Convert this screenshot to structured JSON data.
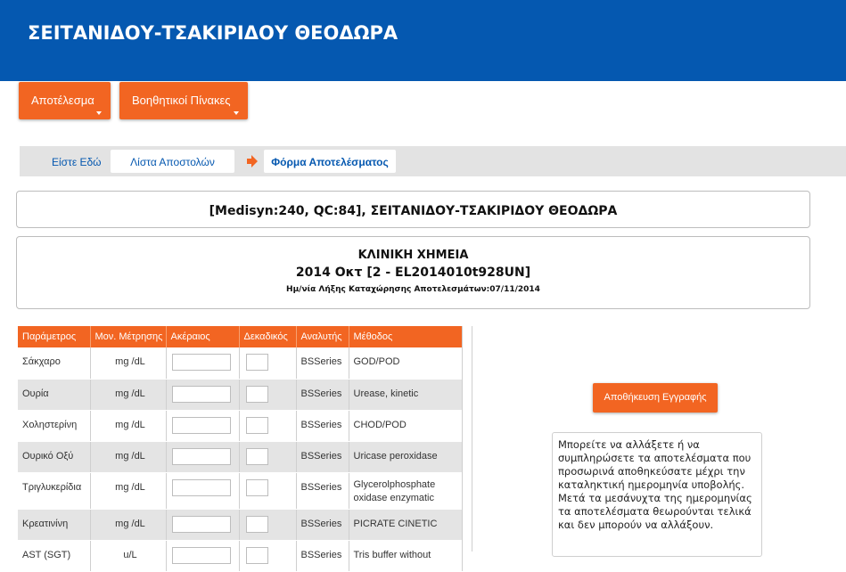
{
  "header": {
    "title": "ΣΕΙΤΑΝΙΔΟΥ-ΤΣΑΚΙΡΙΔΟΥ ΘΕΟΔΩΡΑ"
  },
  "menu": {
    "result_label": "Αποτέλεσμα",
    "tables_label": "Βοηθητικοί Πίνακες"
  },
  "breadcrumb": {
    "label": "Είστε Εδώ",
    "item1": "Λίστα Αποστολών",
    "item2": "Φόρμα Αποτελέσματος"
  },
  "patient": {
    "title": "[Medisyn:240, QC:84], ΣΕΙΤΑΝΙΔΟΥ-ΤΣΑΚΙΡΙΔΟΥ ΘΕΟΔΩΡΑ"
  },
  "section": {
    "title": "ΚΛΙΝΙΚΗ ΧΗΜΕΙΑ",
    "subtitle": "2014 Οκτ [2 - EL2014010t928UN]",
    "deadline": "Ημ/νία Λήξης Καταχώρησης Αποτελεσμάτων:07/11/2014"
  },
  "table": {
    "headers": [
      "Παράμετρος",
      "Μον. Μέτρησης",
      "Ακέραιος",
      "Δεκαδικός",
      "Αναλυτής",
      "Μέθοδος"
    ],
    "rows": [
      {
        "param": "Σάκχαρο",
        "unit": "mg /dL",
        "integer": "",
        "decimal": "",
        "analyzer": "BSSeries",
        "method": "GOD/POD"
      },
      {
        "param": "Ουρία",
        "unit": "mg /dL",
        "integer": "",
        "decimal": "",
        "analyzer": "BSSeries",
        "method": "Urease, kinetic"
      },
      {
        "param": "Χοληστερίνη",
        "unit": "mg /dL",
        "integer": "",
        "decimal": "",
        "analyzer": "BSSeries",
        "method": "CHOD/POD"
      },
      {
        "param": "Ουρικό Οξύ",
        "unit": "mg /dL",
        "integer": "",
        "decimal": "",
        "analyzer": "BSSeries",
        "method": "Uricase peroxidase"
      },
      {
        "param": "Τριγλυκερίδια",
        "unit": "mg /dL",
        "integer": "",
        "decimal": "",
        "analyzer": "BSSeries",
        "method": "Glycerolphosphate oxidase enzymatic"
      },
      {
        "param": "Κρεατινίνη",
        "unit": "mg /dL",
        "integer": "",
        "decimal": "",
        "analyzer": "BSSeries",
        "method": "PICRATE CINETIC"
      },
      {
        "param": "AST (SGT)",
        "unit": "u/L",
        "integer": "",
        "decimal": "",
        "analyzer": "BSSeries",
        "method": "Tris buffer without"
      }
    ]
  },
  "actions": {
    "save_label": "Αποθήκευση Εγγραφής"
  },
  "info": {
    "text": "Μπορείτε να αλλάξετε ή να συμπληρώσετε τα αποτελέσματα που προσωρινά αποθηκεύσατε μέχρι την καταληκτική ημερομηνία υποβολής. Μετά τα μεσάνυχτα της ημερομηνίας τα αποτελέσματα θεωρούνται τελικά και δεν μπορούν να αλλάξουν."
  },
  "colors": {
    "brand": "#0558b0",
    "accent": "#f26522"
  }
}
